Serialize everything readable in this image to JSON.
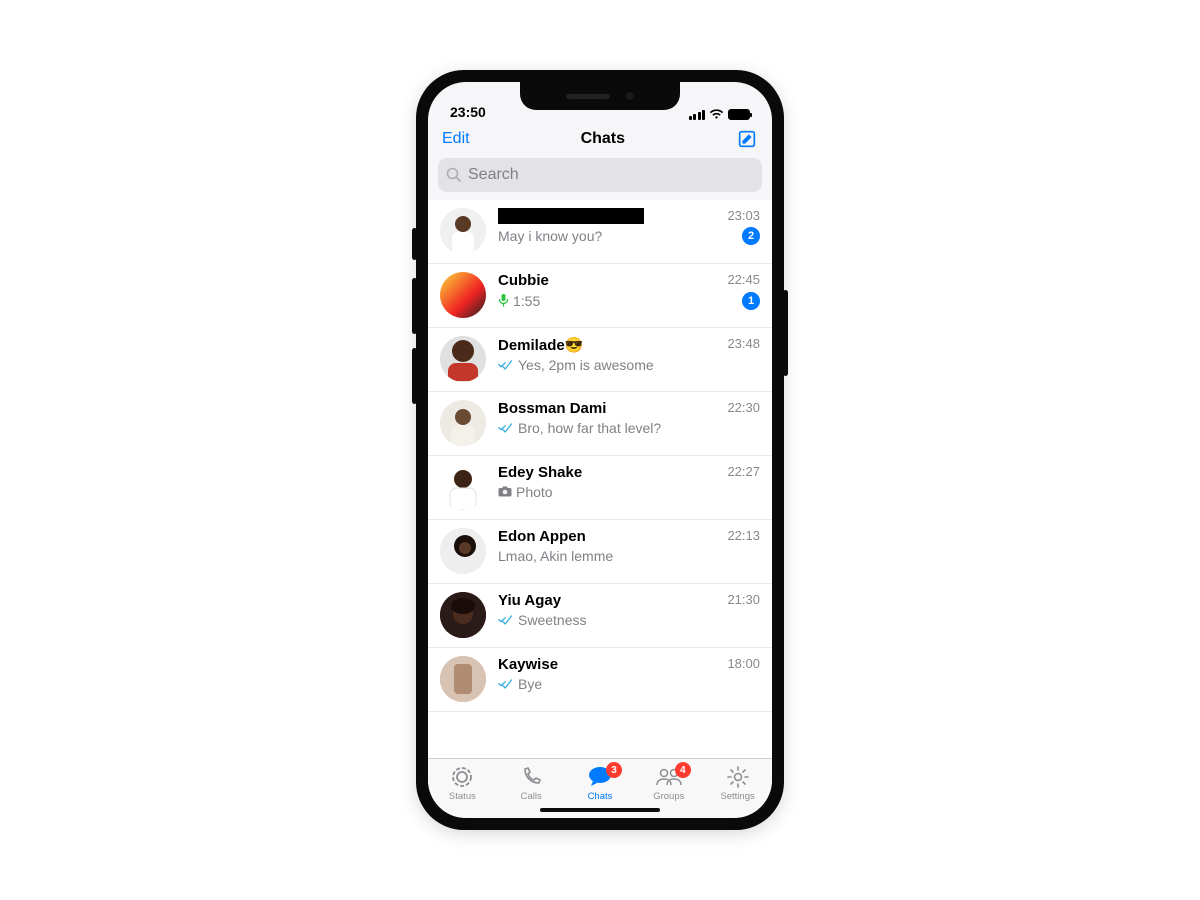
{
  "status_bar": {
    "time": "23:50"
  },
  "header": {
    "edit": "Edit",
    "title": "Chats"
  },
  "search": {
    "placeholder": "Search"
  },
  "chats": [
    {
      "name_redacted": true,
      "time": "23:03",
      "preview": "May i know you?",
      "unread": "2",
      "check": false,
      "icon": null
    },
    {
      "name": "Cubbie",
      "time": "22:45",
      "preview": "1:55",
      "unread": "1",
      "check": false,
      "icon": "mic"
    },
    {
      "name": "Demilade😎",
      "time": "23:48",
      "preview": "Yes, 2pm is awesome",
      "unread": null,
      "check": true,
      "icon": null
    },
    {
      "name": "Bossman Dami",
      "time": "22:30",
      "preview": "Bro, how far that level?",
      "unread": null,
      "check": true,
      "icon": null
    },
    {
      "name": "Edey Shake",
      "time": "22:27",
      "preview": "Photo",
      "unread": null,
      "check": false,
      "icon": "camera"
    },
    {
      "name": "Edon Appen",
      "time": "22:13",
      "preview": "Lmao, Akin lemme",
      "unread": null,
      "check": false,
      "icon": null
    },
    {
      "name": "Yiu Agay",
      "time": "21:30",
      "preview": "Sweetness",
      "unread": null,
      "check": true,
      "icon": null
    },
    {
      "name": "Kaywise",
      "time": "18:00",
      "preview": "Bye",
      "unread": null,
      "check": true,
      "icon": null
    }
  ],
  "tabs": {
    "status": "Status",
    "calls": "Calls",
    "chats": "Chats",
    "groups": "Groups",
    "settings": "Settings",
    "chats_badge": "3",
    "groups_badge": "4"
  }
}
